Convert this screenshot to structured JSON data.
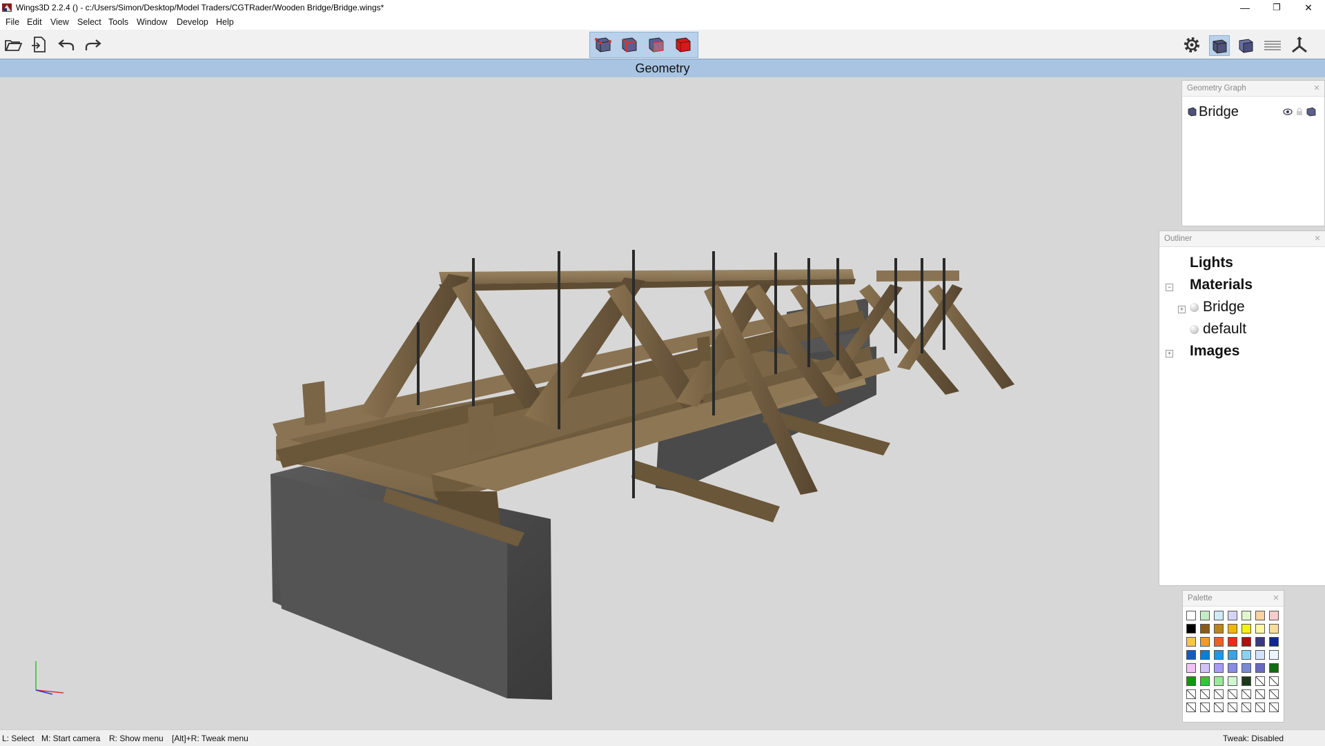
{
  "window": {
    "title": "Wings3D 2.2.4 () - c:/Users/Simon/Desktop/Model Traders/CGTRader/Wooden Bridge/Bridge.wings*",
    "controls": {
      "minimize": "—",
      "maximize": "❐",
      "close": "✕"
    }
  },
  "menu": {
    "items": [
      "File",
      "Edit",
      "View",
      "Select",
      "Tools",
      "Window",
      "Develop",
      "Help"
    ]
  },
  "toolbar": {
    "left_icons": [
      "open-folder-icon",
      "import-icon",
      "undo-icon",
      "redo-icon"
    ],
    "selection_modes": [
      "vertex-mode-icon",
      "edge-mode-icon",
      "face-mode-icon",
      "body-mode-icon"
    ],
    "right_icons": [
      "settings-gear-icon",
      "smooth-shaded-icon",
      "flat-shaded-icon",
      "ground-plane-icon",
      "axes-icon"
    ]
  },
  "viewport": {
    "header": "Geometry",
    "object_name": "Bridge"
  },
  "geometry_graph": {
    "title": "Geometry Graph",
    "objects": [
      {
        "name": "Bridge",
        "visible_icon": "eye-icon",
        "lock_icon": "lock-icon",
        "shade_icon": "cube-icon"
      }
    ]
  },
  "outliner": {
    "title": "Outliner",
    "lights": "Lights",
    "materials": "Materials",
    "material_items": [
      "Bridge",
      "default"
    ],
    "images": "Images"
  },
  "palette": {
    "title": "Palette",
    "colors": [
      [
        "#ffffff",
        "#c6ecc6",
        "#cfeaf6",
        "#d4d4f5",
        "#e0f6cf",
        "#f8d2a2",
        "#f7cccc"
      ],
      [
        "#000000",
        "#8a5a1a",
        "#b8861a",
        "#f1b60a",
        "#f3f312",
        "#faf7a6",
        "#f7dba0"
      ],
      [
        "#f6c54a",
        "#f39a2a",
        "#f55a2a",
        "#f02a1a",
        "#b20f0f",
        "#3a3a7a",
        "#0f2a8a"
      ],
      [
        "#0a5fc0",
        "#0a7fd0",
        "#1a9ae8",
        "#3aa2e8",
        "#8ad2f5",
        "#d2e2fa",
        "#eaf5ff"
      ],
      [
        "#f2c2f2",
        "#d2c2f8",
        "#a79cf5",
        "#8a8ae8",
        "#7a8ad8",
        "#6a6ac2",
        "#156a15"
      ],
      [
        "#0a9a0a",
        "#3ac23a",
        "#9ae89a",
        "#d2f5d2",
        "#1a3a1a",
        "",
        ""
      ],
      [
        "",
        "",
        "",
        "",
        "",
        "",
        ""
      ],
      [
        "",
        "",
        "",
        "",
        "",
        "",
        ""
      ]
    ]
  },
  "status": {
    "left": [
      "L: Select",
      "M: Start camera",
      "R: Show menu",
      "[Alt]+R: Tweak menu"
    ],
    "right": "Tweak: Disabled"
  }
}
